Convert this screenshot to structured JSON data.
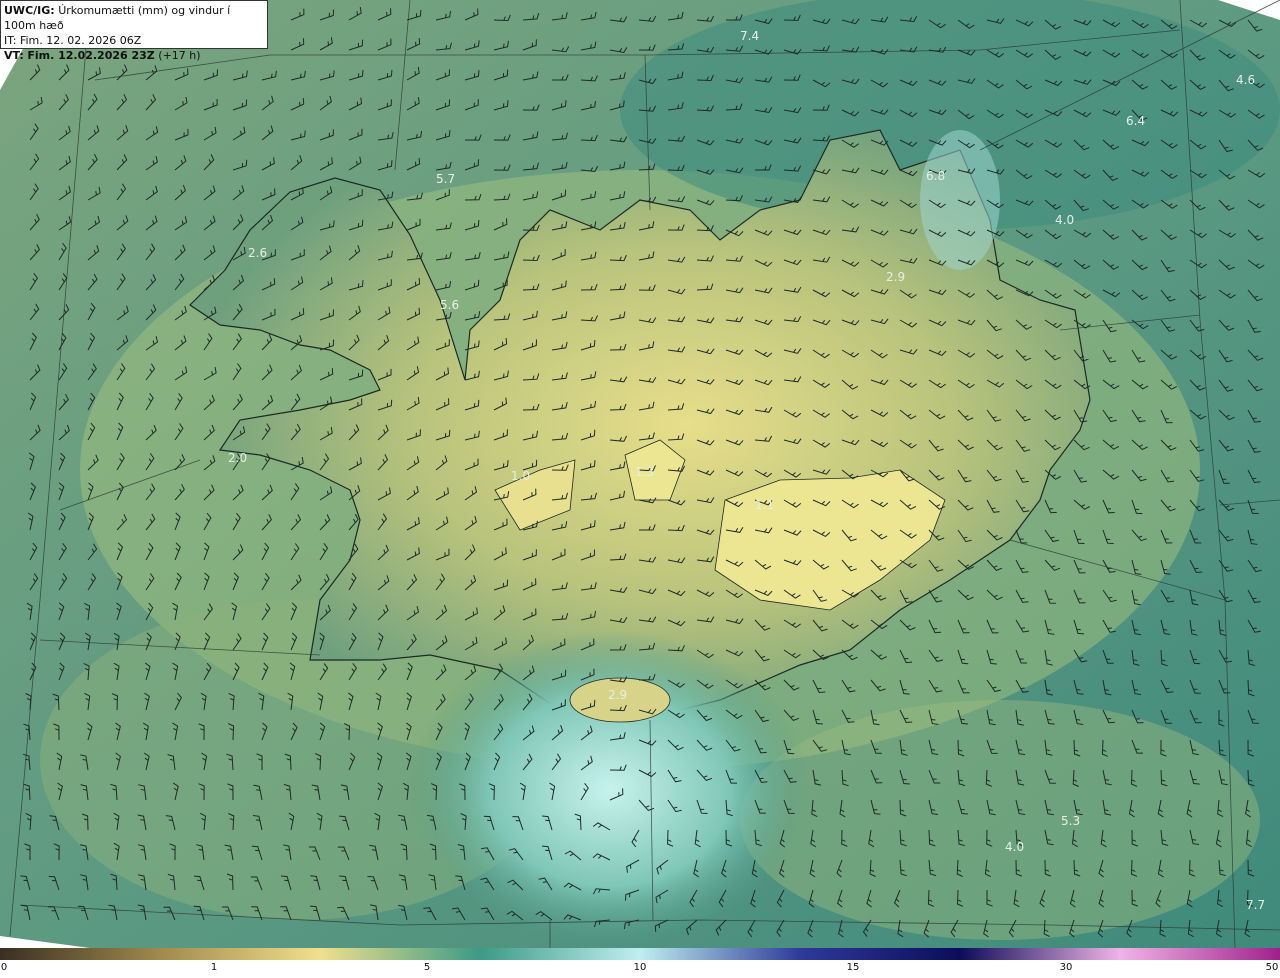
{
  "header": {
    "title_prefix": "UWC/IG:",
    "title_text": "Úrkomumætti (mm) og vindur í 100m hæð",
    "it_prefix": "IT:",
    "it_text": "Fim. 12. 02. 2026 06Z",
    "vt_prefix": "VT:",
    "vt_text": "Fim. 12.02.2026 23Z",
    "vt_suffix": "(+17 h)"
  },
  "map_values": [
    "7.4",
    "4.6",
    "6.4",
    "5.7",
    "6.8",
    "4.0",
    "2.6",
    "2.9",
    "5.6",
    "2.0",
    "1.0",
    "1.3",
    "1.1",
    "2.9",
    "5.3",
    "4.0",
    "7.7"
  ],
  "colorbar": {
    "ticks": [
      "0",
      "1",
      "5",
      "10",
      "15",
      "30",
      "50"
    ],
    "colors": [
      "#3a2f22",
      "#a08a4c",
      "#f0e08c",
      "#3c9a86",
      "#bfeff0",
      "#2e3a9a",
      "#0c0c5a",
      "#f0b4e6",
      "#a0208c"
    ]
  }
}
